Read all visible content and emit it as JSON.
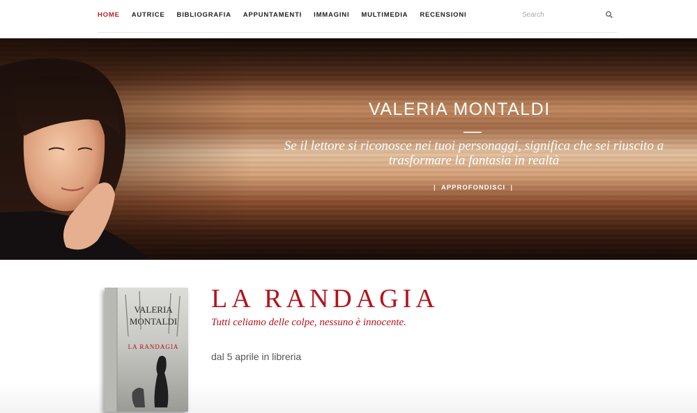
{
  "nav": {
    "items": [
      {
        "label": "HOME",
        "active": true
      },
      {
        "label": "AUTRICE",
        "active": false
      },
      {
        "label": "BIBLIOGRAFIA",
        "active": false
      },
      {
        "label": "APPUNTAMENTI",
        "active": false
      },
      {
        "label": "IMMAGINI",
        "active": false
      },
      {
        "label": "MULTIMEDIA",
        "active": false
      },
      {
        "label": "RECENSIONI",
        "active": false
      }
    ],
    "search": {
      "placeholder": "Search",
      "icon": "search-icon"
    },
    "active_color": "#c0202a"
  },
  "hero": {
    "title": "VALERIA MONTALDI",
    "quote_line1": "Se il lettore si riconosce nei tuoi personaggi, significa che sei riuscito a",
    "quote_line2": "trasformare la fantasia in realtà",
    "button_label": "APPROFONDISCI",
    "button_bar": "|"
  },
  "book": {
    "title": "LA RANDAGIA",
    "tagline": "Tutti celiamo delle colpe, nessuno è innocente.",
    "release": "dal 5 aprile in libreria",
    "cover": {
      "author_first": "VALERIA",
      "author_last": "MONTALDI",
      "title": "LA RANDAGIA"
    },
    "accent_color": "#b5121b"
  }
}
